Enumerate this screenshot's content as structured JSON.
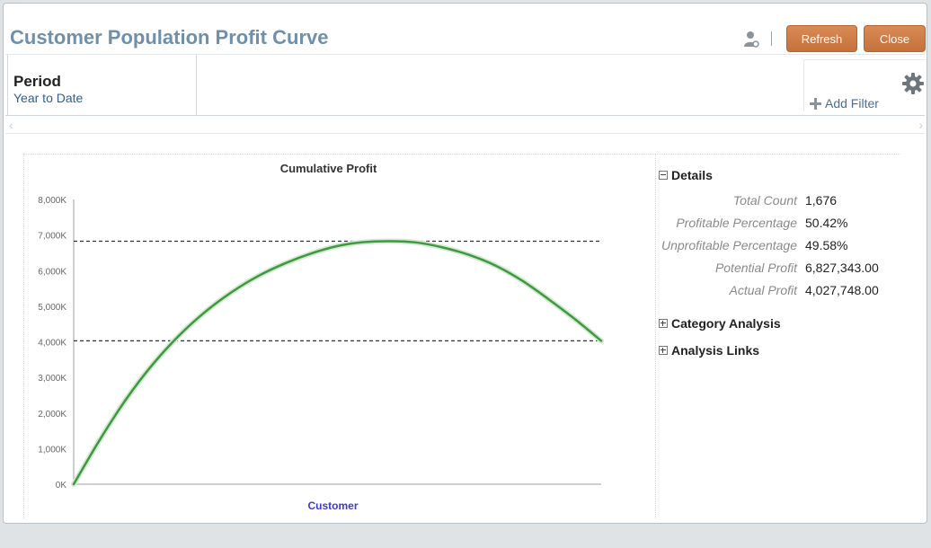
{
  "window": {
    "title": "Customer Population Profit Curve",
    "buttons": {
      "refresh": "Refresh",
      "close": "Close"
    }
  },
  "filters": {
    "period": {
      "label": "Period",
      "value": "Year to Date"
    },
    "add_filter_label": "Add Filter"
  },
  "icons": {
    "user": "user-settings-icon",
    "plus": "plus-icon",
    "gear": "gear-icon",
    "scroll_left": "chevron-left-icon",
    "scroll_right": "chevron-right-icon"
  },
  "colors": {
    "title": "#6f8faa",
    "button": "#c97340",
    "curve": "#3d9a3d",
    "reference_line": "#333333",
    "xlabel": "#3b3bd4"
  },
  "chart_data": {
    "type": "line",
    "title": "Cumulative Profit",
    "xlabel": "Customer",
    "ylabel": "",
    "ylim": [
      0,
      8000
    ],
    "yticks": [
      0,
      1000,
      2000,
      3000,
      4000,
      5000,
      6000,
      7000,
      8000
    ],
    "ytick_labels": [
      "0K",
      "1,000K",
      "2,000K",
      "3,000K",
      "4,000K",
      "5,000K",
      "6,000K",
      "7,000K",
      "8,000K"
    ],
    "x_fraction": [
      0,
      0.05,
      0.1,
      0.15,
      0.2,
      0.25,
      0.3,
      0.35,
      0.4,
      0.45,
      0.5,
      0.55,
      0.6,
      0.65,
      0.7,
      0.75,
      0.8,
      0.85,
      0.9,
      0.95,
      1.0
    ],
    "series": [
      {
        "values": [
          0,
          1260,
          2400,
          3370,
          4180,
          4850,
          5400,
          5850,
          6200,
          6480,
          6690,
          6800,
          6827,
          6790,
          6650,
          6440,
          6140,
          5720,
          5200,
          4640,
          4028
        ]
      }
    ],
    "reference_lines": [
      {
        "value": 6827,
        "style": "dashed"
      },
      {
        "value": 4028,
        "style": "dashed"
      }
    ],
    "grid": false
  },
  "details": {
    "details_header": "Details",
    "rows": [
      {
        "label": "Total Count",
        "value": "1,676"
      },
      {
        "label": "Profitable Percentage",
        "value": "50.42%"
      },
      {
        "label": "Unprofitable Percentage",
        "value": "49.58%"
      },
      {
        "label": "Potential Profit",
        "value": "6,827,343.00"
      },
      {
        "label": "Actual Profit",
        "value": "4,027,748.00"
      }
    ],
    "category_analysis_header": "Category Analysis",
    "analysis_links_header": "Analysis Links"
  }
}
